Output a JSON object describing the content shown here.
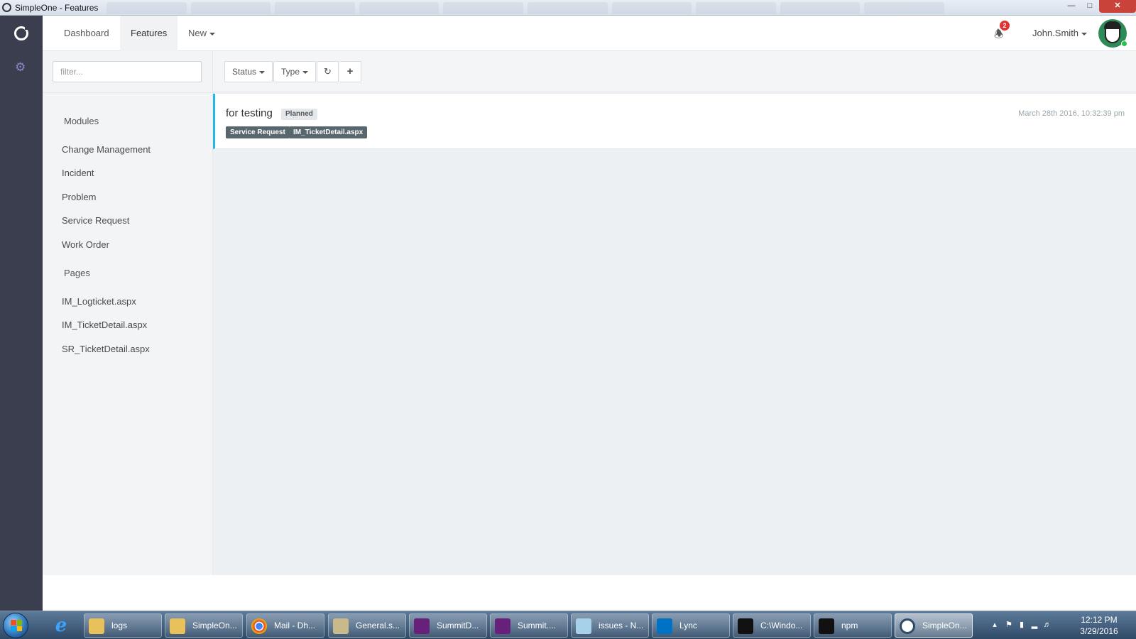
{
  "window": {
    "title": "SimpleOne - Features"
  },
  "topnav": {
    "items": [
      {
        "label": "Dashboard"
      },
      {
        "label": "Features"
      },
      {
        "label": "New"
      }
    ],
    "notifications_count": "2",
    "user_name": "John.Smith"
  },
  "sidebar": {
    "filter_placeholder": "filter...",
    "modules_heading": "Modules",
    "modules": [
      "Change Management",
      "Incident",
      "Problem",
      "Service Request",
      "Work Order"
    ],
    "pages_heading": "Pages",
    "pages": [
      "IM_Logticket.aspx",
      "IM_TicketDetail.aspx",
      "SR_TicketDetail.aspx"
    ]
  },
  "toolbar": {
    "status_label": "Status",
    "type_label": "Type",
    "refresh_icon": "refresh-icon",
    "add_icon": "plus-icon"
  },
  "features": [
    {
      "title": "for testing",
      "status": "Planned",
      "tags": [
        "Service Request",
        "IM_TicketDetail.aspx"
      ],
      "date": "March 28th 2016, 10:32:39 pm"
    }
  ],
  "taskbar": {
    "items": [
      {
        "label": "logs"
      },
      {
        "label": "SimpleOn..."
      },
      {
        "label": "Mail - Dh..."
      },
      {
        "label": "General.s..."
      },
      {
        "label": "SummitD..."
      },
      {
        "label": "Summit...."
      },
      {
        "label": "issues - N..."
      },
      {
        "label": "Lync"
      },
      {
        "label": "C:\\Windo..."
      },
      {
        "label": "npm"
      },
      {
        "label": "SimpleOn..."
      }
    ],
    "clock_time": "12:12 PM",
    "clock_date": "3/29/2016"
  },
  "colors": {
    "rail": "#3a3e4e",
    "accent": "#23b7e5",
    "badge": "#e2322f",
    "tag": "#58666e"
  }
}
